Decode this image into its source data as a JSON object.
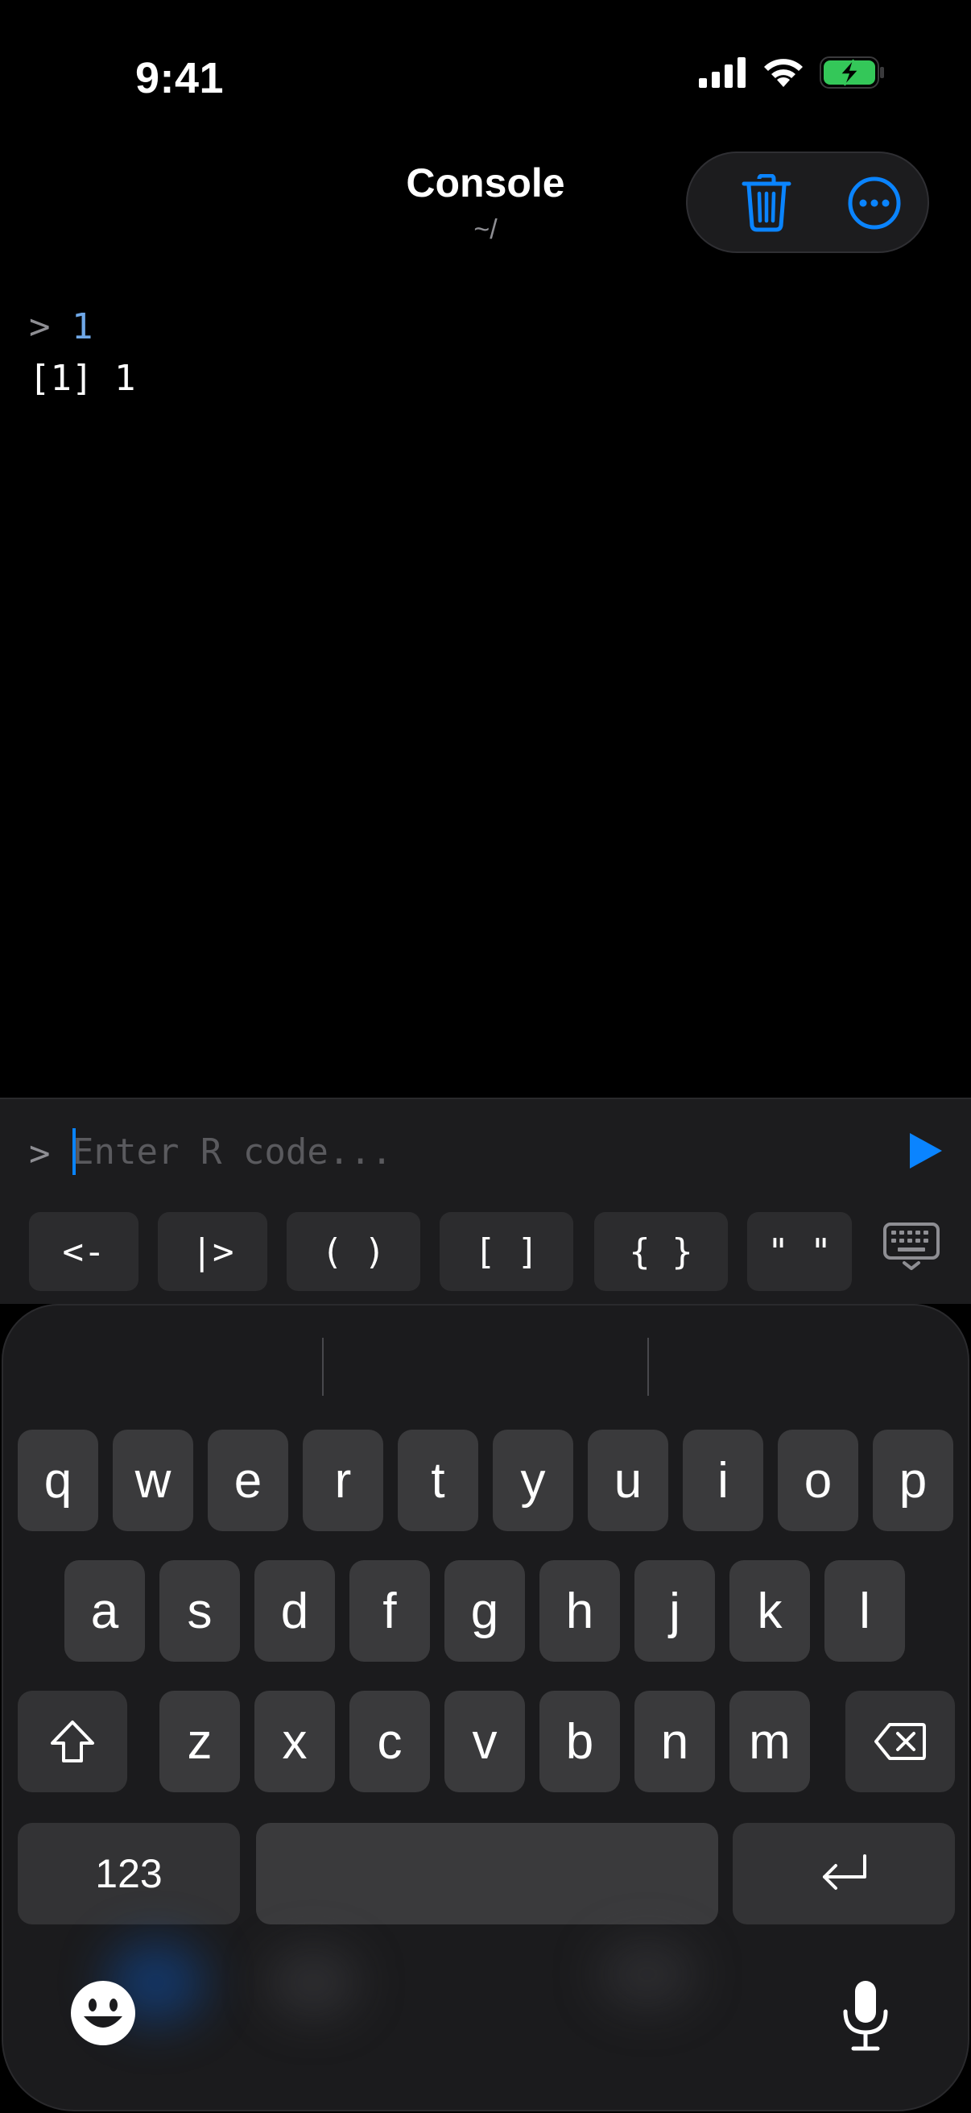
{
  "status_bar": {
    "time": "9:41"
  },
  "nav": {
    "title": "Console",
    "subtitle": "~/"
  },
  "console": {
    "lines": [
      {
        "prompt": ">",
        "text": "1"
      },
      {
        "prompt": "",
        "text": "[1] 1"
      }
    ]
  },
  "input": {
    "prompt": ">",
    "placeholder": "Enter R code...",
    "value": ""
  },
  "snippets": [
    "<-",
    "|>",
    "( )",
    "[ ]",
    "{ }",
    "\" \""
  ],
  "keyboard": {
    "row1": [
      "q",
      "w",
      "e",
      "r",
      "t",
      "y",
      "u",
      "i",
      "o",
      "p"
    ],
    "row2": [
      "a",
      "s",
      "d",
      "f",
      "g",
      "h",
      "j",
      "k",
      "l"
    ],
    "row3": [
      "z",
      "x",
      "c",
      "v",
      "b",
      "n",
      "m"
    ],
    "numbers_label": "123"
  },
  "colors": {
    "accent": "#0a84ff",
    "console_input": "#6fa8e8",
    "battery": "#34c759"
  },
  "icons": {
    "signal": "cellular-signal-icon",
    "wifi": "wifi-icon",
    "battery": "battery-charging-icon",
    "delete": "trash-icon",
    "more": "ellipsis-circle-icon",
    "run": "play-icon",
    "hide_keyboard": "keyboard-dismiss-icon",
    "shift": "shift-icon",
    "backspace": "backspace-icon",
    "return": "return-icon",
    "emoji": "emoji-icon",
    "dictation": "microphone-icon"
  }
}
